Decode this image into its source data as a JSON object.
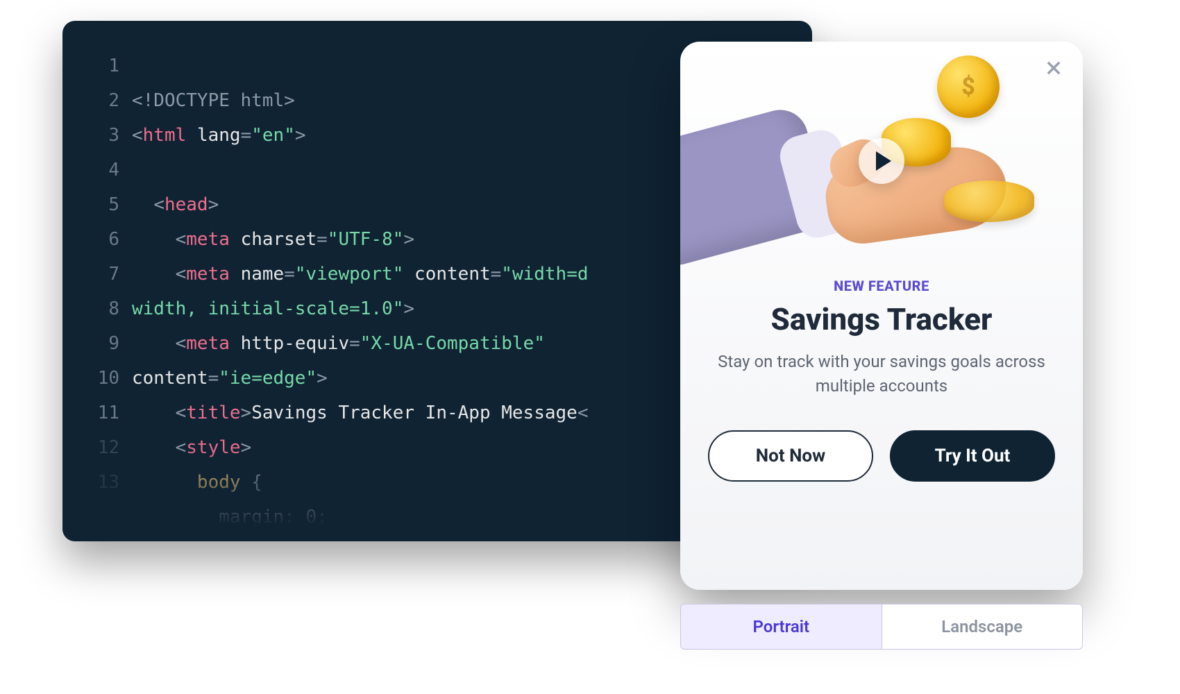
{
  "code": {
    "line_numbers": [
      "1",
      "2",
      "3",
      "4",
      "5",
      "6",
      "7",
      "8",
      "9",
      "10",
      "11",
      "12",
      "13"
    ],
    "lines": {
      "l1": {
        "d": "<!DOCTYPE html>"
      },
      "l2": {
        "open": "<",
        "tag": "html",
        "sp": " ",
        "attr": "lang",
        "eq": "=",
        "q": "\"",
        "val": "en",
        "close": ">"
      },
      "l3": {
        "blank": ""
      },
      "l4": {
        "open": "<",
        "tag": "head",
        "close": ">"
      },
      "l5": {
        "open": "<",
        "tag": "meta",
        "sp": " ",
        "attr": "charset",
        "eq": "=",
        "q": "\"",
        "val": "UTF-8",
        "close": ">"
      },
      "l6": {
        "open": "<",
        "tag": "meta",
        "sp": " ",
        "attr1": "name",
        "val1": "viewport",
        "attr2": "content",
        "val2": "width=d"
      },
      "l7": {
        "text": "width, initial-scale=1.0",
        "q": "\"",
        "close": ">"
      },
      "l8": {
        "open": "<",
        "tag": "meta",
        "sp": " ",
        "attr": "http-equiv",
        "eq": "=",
        "q": "\"",
        "val": "X-UA-Compatible",
        "q2": "\""
      },
      "l9": {
        "attr": "content",
        "eq": "=",
        "q": "\"",
        "val": "ie=edge",
        "q2": "\"",
        "close": ">"
      },
      "l10": {
        "open": "<",
        "tag": "title",
        "close": ">",
        "text": "Savings Tracker In-App Message",
        "open2": "<"
      },
      "l11": {
        "open": "<",
        "tag": "style",
        "close": ">"
      },
      "l12": {
        "sel": "body",
        "brace": " {"
      },
      "l13": {
        "prop": "margin",
        "colon": ": ",
        "val": "0",
        "semi": ";"
      }
    }
  },
  "preview": {
    "eyebrow": "NEW FEATURE",
    "title": "Savings Tracker",
    "description": "Stay on track with your savings goals across multiple accounts",
    "secondary_label": "Not Now",
    "primary_label": "Try It Out"
  },
  "orientation": {
    "portrait": "Portrait",
    "landscape": "Landscape"
  }
}
